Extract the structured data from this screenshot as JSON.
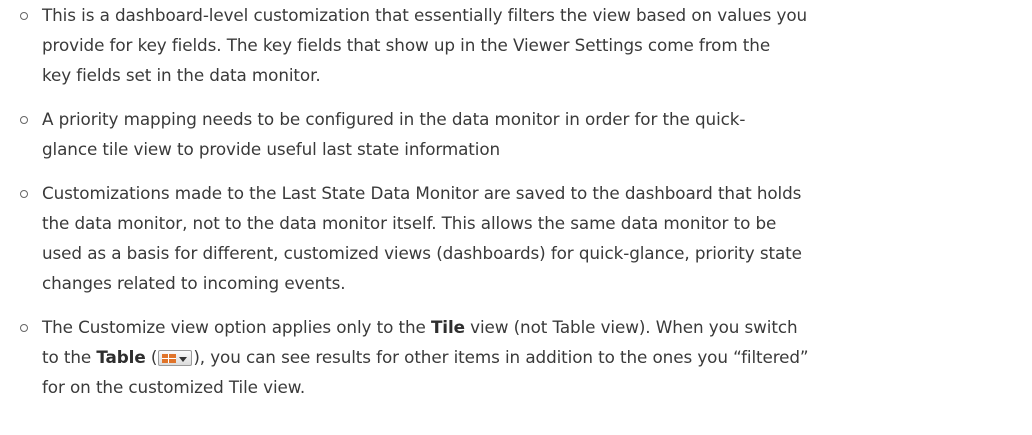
{
  "bullets": [
    {
      "lines": [
        "This is a dashboard-level customization that essentially filters the view based on values you",
        "provide for key fields. The key fields that show up in the Viewer Settings come from the",
        "key fields set in the data monitor."
      ]
    },
    {
      "lines": [
        "A priority mapping needs to be configured in the data monitor in order for the quick-",
        "glance tile view to provide useful last state information"
      ]
    },
    {
      "lines": [
        "Customizations made to the Last State Data Monitor are saved to the dashboard that holds",
        "the data monitor, not to the data monitor itself. This allows the same data monitor to be",
        "used as a basis for different, customized views (dashboards) for quick-glance, priority state",
        "changes related to incoming events."
      ]
    },
    {
      "segments": {
        "l1_a": "The Customize view option applies only to the ",
        "l1_bold": "Tile",
        "l1_b": " view (not Table view). When you switch",
        "l2_a": "to the ",
        "l2_bold": "Table",
        "l2_b": " (",
        "l2_c": "), you can see results for other items in addition to the ones you “filtered”",
        "l3": "for on the customized Tile view."
      },
      "icon": "table-view-dropdown-icon"
    }
  ],
  "colors": {
    "text": "#3a3a3a",
    "bullet": "#666666",
    "icon_accent": "#e0742a"
  }
}
